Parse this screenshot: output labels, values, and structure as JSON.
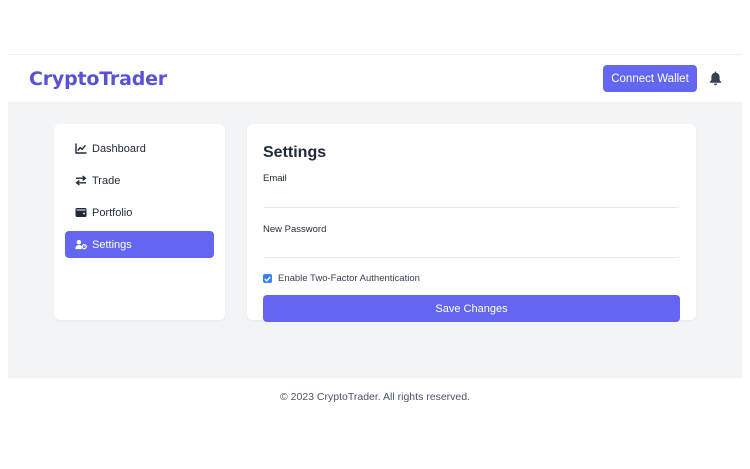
{
  "header": {
    "logo": "CryptoTrader",
    "connect_wallet_label": "Connect Wallet",
    "notification_icon": "bell-icon"
  },
  "sidebar": {
    "items": [
      {
        "label": "Dashboard",
        "icon": "chart-line-icon",
        "active": false
      },
      {
        "label": "Trade",
        "icon": "exchange-arrows-icon",
        "active": false
      },
      {
        "label": "Portfolio",
        "icon": "wallet-icon",
        "active": false
      },
      {
        "label": "Settings",
        "icon": "user-cog-icon",
        "active": true
      }
    ]
  },
  "settings": {
    "title": "Settings",
    "email_label": "Email",
    "email_value": "",
    "password_label": "New Password",
    "password_value": "",
    "two_factor_label": "Enable Two-Factor Authentication",
    "two_factor_checked": true,
    "save_label": "Save Changes"
  },
  "footer": {
    "text": "© 2023 CryptoTrader. All rights reserved."
  },
  "colors": {
    "brand": "#5a52d5",
    "accent": "#6366f1",
    "checkbox": "#3b82f6",
    "background": "#f3f4f6"
  }
}
